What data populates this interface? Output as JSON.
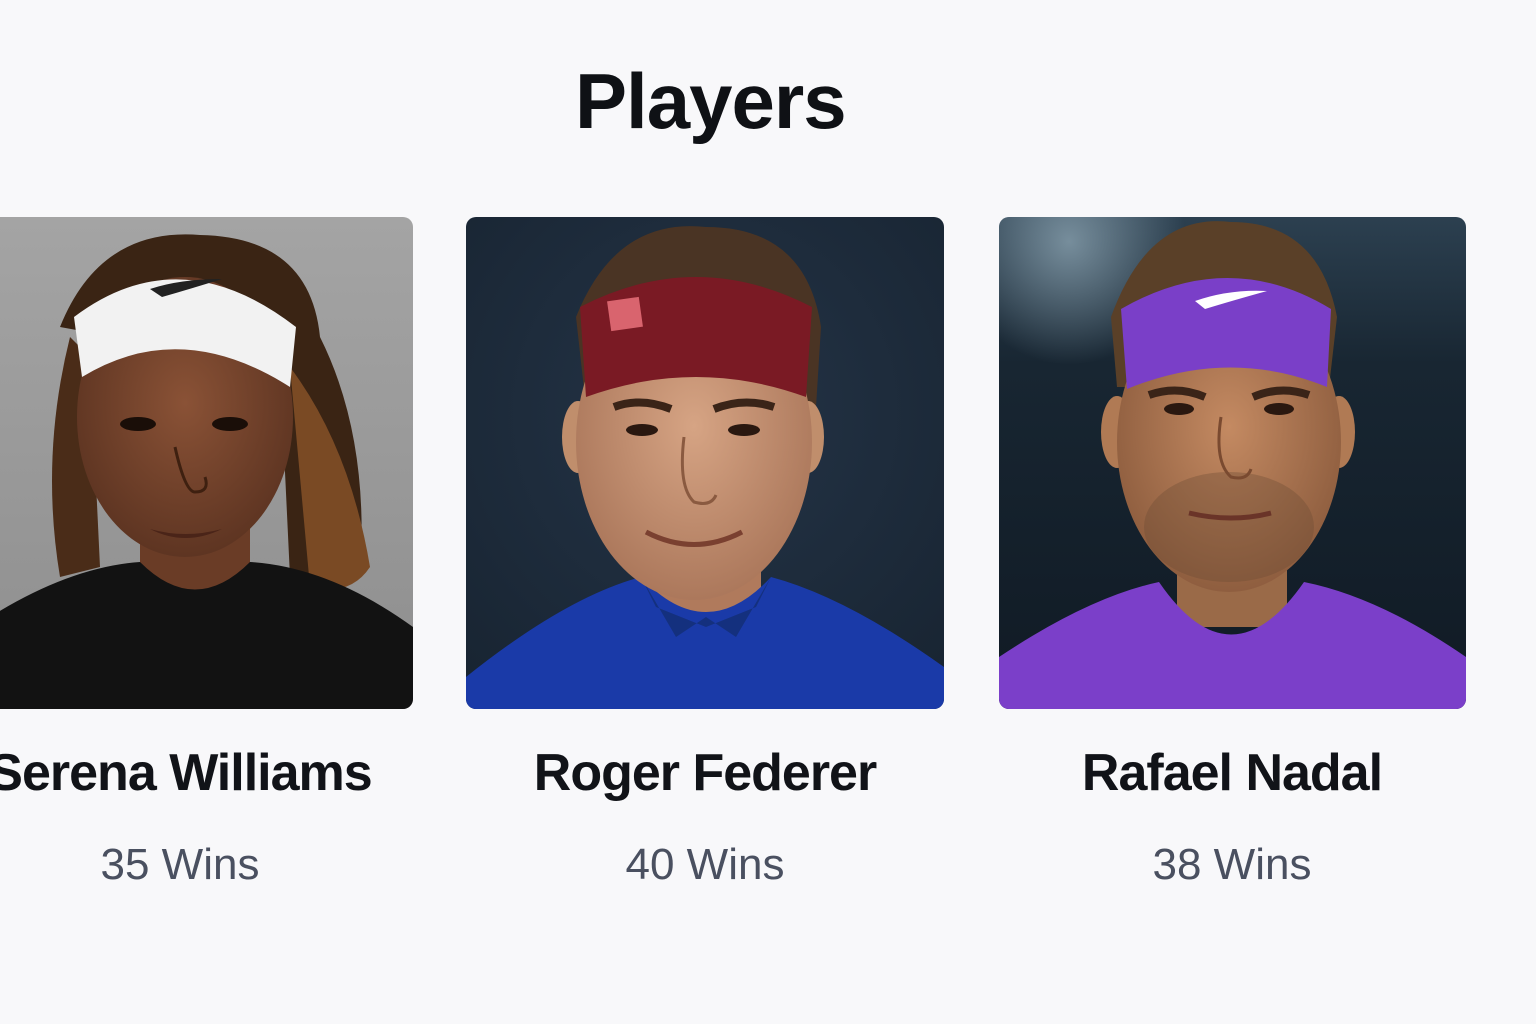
{
  "page": {
    "title": "Players"
  },
  "players": [
    {
      "name": "Serena Williams",
      "wins": "35 Wins",
      "headband_color": "#f2f2f2",
      "shirt_color": "#111111",
      "background_color": "#9a9a9a"
    },
    {
      "name": "Roger Federer",
      "wins": "40 Wins",
      "headband_color": "#7a1a24",
      "shirt_color": "#1a3aa8",
      "background_color": "#1c2a3a"
    },
    {
      "name": "Rafael Nadal",
      "wins": "38 Wins",
      "headband_color": "#7a3fc8",
      "shirt_color": "#7b3fc9",
      "background_color": "#13202c"
    }
  ]
}
